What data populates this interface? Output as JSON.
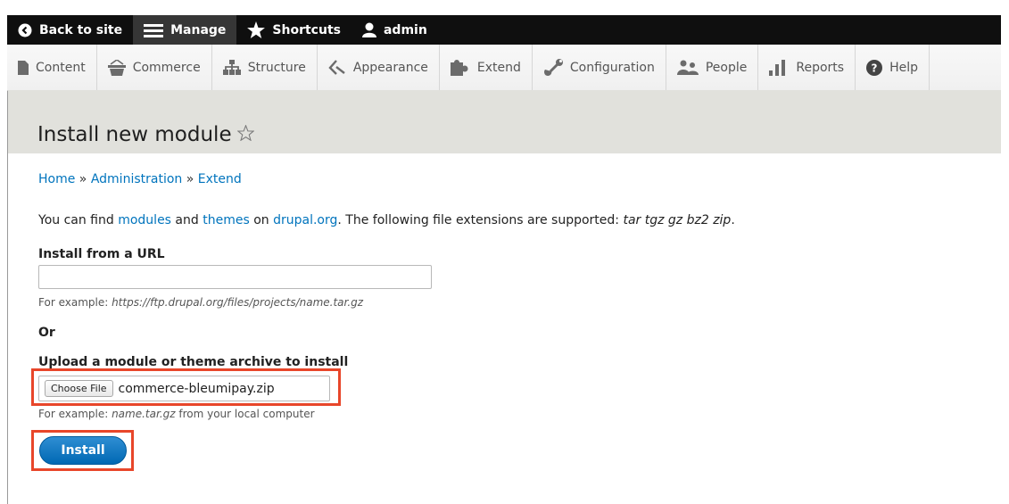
{
  "toolbar": {
    "back_to_site": "Back to site",
    "manage": "Manage",
    "shortcuts": "Shortcuts",
    "user": "admin"
  },
  "tray": {
    "items": [
      {
        "label": "Content",
        "icon": "page-icon"
      },
      {
        "label": "Commerce",
        "icon": "basket-icon"
      },
      {
        "label": "Structure",
        "icon": "sitemap-icon"
      },
      {
        "label": "Appearance",
        "icon": "paintbrush-icon"
      },
      {
        "label": "Extend",
        "icon": "puzzle-icon"
      },
      {
        "label": "Configuration",
        "icon": "wrench-icon"
      },
      {
        "label": "People",
        "icon": "people-icon"
      },
      {
        "label": "Reports",
        "icon": "bar-chart-icon"
      },
      {
        "label": "Help",
        "icon": "question-icon"
      }
    ]
  },
  "page": {
    "title": "Install new module"
  },
  "breadcrumb": {
    "home": "Home",
    "administration": "Administration",
    "extend": "Extend",
    "separator": "»"
  },
  "intro": {
    "part1": "You can find ",
    "modules_link": "modules",
    "part2": " and ",
    "themes_link": "themes",
    "part3": " on ",
    "drupal_link": "drupal.org",
    "part4": ". The following file extensions are supported: ",
    "extensions": "tar tgz gz bz2 zip",
    "part5": "."
  },
  "url_field": {
    "label": "Install from a URL",
    "value": "",
    "desc_prefix": "For example: ",
    "desc_example": "https://ftp.drupal.org/files/projects/name.tar.gz"
  },
  "or_label": "Or",
  "upload_field": {
    "label": "Upload a module or theme archive to install",
    "choose_button": "Choose File",
    "file_name": "commerce-bleumipay.zip",
    "desc_prefix": "For example: ",
    "desc_example": "name.tar.gz",
    "desc_suffix": " from your local computer"
  },
  "install_button": "Install",
  "colors": {
    "toolbar_bg": "#0f0f0f",
    "link": "#0074bd",
    "primary_button": "#0068b3",
    "highlight": "#e8462a",
    "header_bg": "#e1e1dc"
  }
}
